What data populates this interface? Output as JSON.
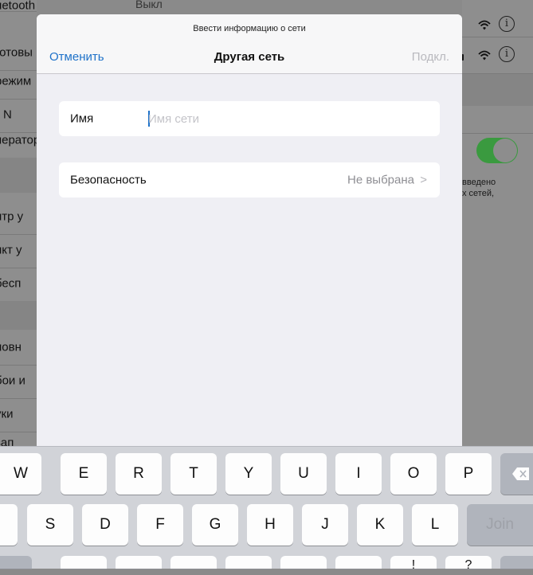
{
  "background_left_rows": [
    "uetooth",
    "готовы",
    "режим",
    "N",
    "ператор",
    "",
    "нтр у",
    "нкт у",
    "бесп",
    "",
    "новн",
    "бои и",
    "уки",
    "зап"
  ],
  "background_bluetooth_value": "Выкл",
  "background_note": [
    "введено",
    "х сетей,"
  ],
  "sheet": {
    "prompt": "Ввести информацию о сети",
    "cancel_label": "Отменить",
    "title": "Другая сеть",
    "connect_label": "Подкл.",
    "name_label": "Имя",
    "name_placeholder": "Имя сети",
    "name_value": "",
    "security_label": "Безопасность",
    "security_value": "Не выбрана",
    "chevron": ">"
  },
  "keyboard": {
    "row1": [
      "W",
      "E",
      "R",
      "T",
      "Y",
      "U",
      "I",
      "O",
      "P"
    ],
    "row2": [
      "S",
      "D",
      "F",
      "G",
      "H",
      "J",
      "K",
      "L"
    ],
    "row3_partial": [
      "!",
      "?"
    ],
    "backspace_icon": "backspace-icon",
    "join_label": "Join"
  },
  "colors": {
    "accent": "#1f72c9",
    "toggle_on": "#3a9a3f",
    "dim_background": "#8e8e8e",
    "sheet_background": "#efeff4",
    "keyboard_background": "#d1d3d8"
  }
}
